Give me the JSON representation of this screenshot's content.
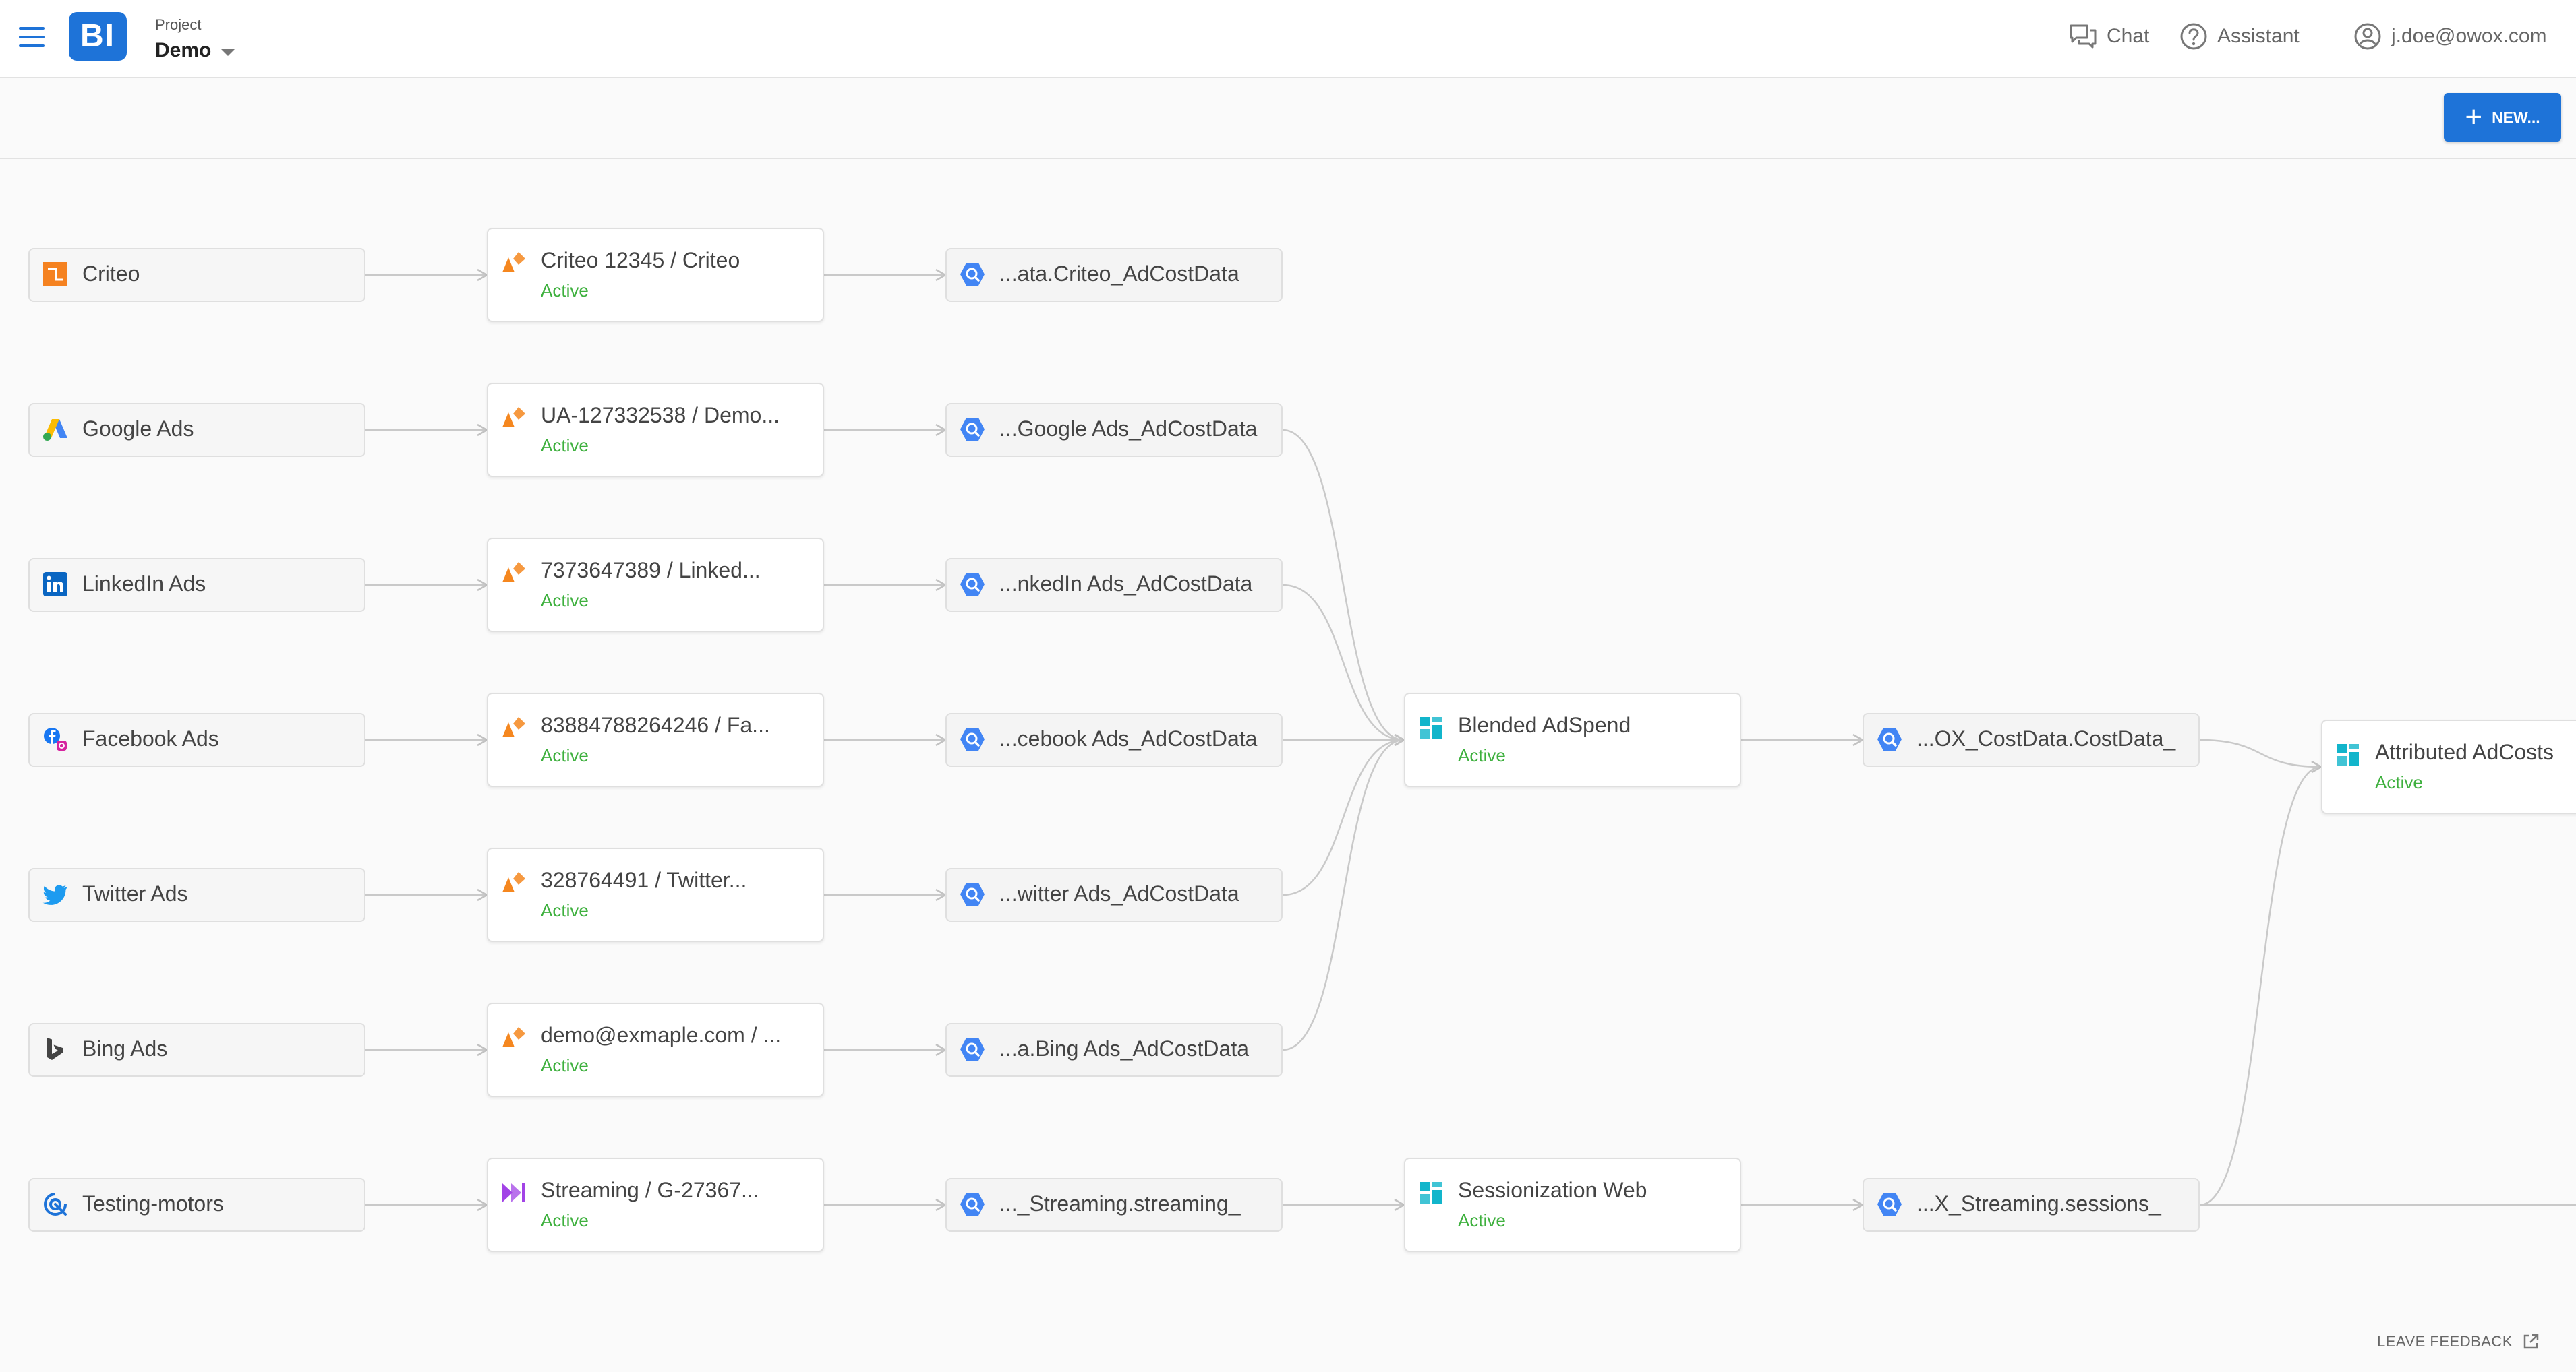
{
  "header": {
    "project_label": "Project",
    "project_name": "Demo",
    "chat_label": "Chat",
    "assistant_label": "Assistant",
    "user_email": "j.doe@owox.com"
  },
  "toolbar": {
    "new_label": "NEW..."
  },
  "footer": {
    "feedback_label": "LEAVE FEEDBACK"
  },
  "colors": {
    "brand_blue": "#1e73d8",
    "status_green": "#3eb03e",
    "pipeline_orange": "#f5871f",
    "table_blue": "#4285f4",
    "blend_teal": "#12b5cb",
    "stream_purple": "#a243e6"
  },
  "rows": [
    {
      "source": "Criteo",
      "source_icon": "criteo-icon",
      "pipeline": "Criteo 12345 / Criteo",
      "pipeline_icon": "pipeline-icon",
      "pipeline_status": "Active",
      "table": "...ata.Criteo_AdCostData",
      "table_icon": "bigquery-icon"
    },
    {
      "source": "Google Ads",
      "source_icon": "google-ads-icon",
      "pipeline": "UA-127332538 / Demo...",
      "pipeline_icon": "pipeline-icon",
      "pipeline_status": "Active",
      "table": "...Google Ads_AdCostData",
      "table_icon": "bigquery-icon"
    },
    {
      "source": "LinkedIn Ads",
      "source_icon": "linkedin-icon",
      "pipeline": "7373647389 / Linked...",
      "pipeline_icon": "pipeline-icon",
      "pipeline_status": "Active",
      "table": "...nkedIn Ads_AdCostData",
      "table_icon": "bigquery-icon"
    },
    {
      "source": "Facebook Ads",
      "source_icon": "facebook-icon",
      "pipeline": "83884788264246 / Fa...",
      "pipeline_icon": "pipeline-icon",
      "pipeline_status": "Active",
      "table": "...cebook Ads_AdCostData",
      "table_icon": "bigquery-icon"
    },
    {
      "source": "Twitter Ads",
      "source_icon": "twitter-icon",
      "pipeline": "328764491 / Twitter...",
      "pipeline_icon": "pipeline-icon",
      "pipeline_status": "Active",
      "table": "...witter Ads_AdCostData",
      "table_icon": "bigquery-icon"
    },
    {
      "source": "Bing Ads",
      "source_icon": "bing-icon",
      "pipeline": "demo@exmaple.com / ...",
      "pipeline_icon": "pipeline-icon",
      "pipeline_status": "Active",
      "table": "...a.Bing Ads_AdCostData",
      "table_icon": "bigquery-icon"
    },
    {
      "source": "Testing-motors",
      "source_icon": "streaming-source-icon",
      "pipeline": "Streaming / G-27367...",
      "pipeline_icon": "streaming-icon",
      "pipeline_status": "Active",
      "table": "..._Streaming.streaming_",
      "table_icon": "bigquery-icon"
    }
  ],
  "blends": [
    {
      "title": "Blended AdSpend",
      "status": "Active",
      "icon": "blend-icon",
      "output_table": "...OX_CostData.CostData_"
    },
    {
      "title": "Sessionization Web",
      "status": "Active",
      "icon": "blend-icon",
      "output_table": "...X_Streaming.sessions_"
    }
  ],
  "attribution": {
    "title": "Attributed AdCosts",
    "status": "Active",
    "icon": "blend-icon"
  }
}
